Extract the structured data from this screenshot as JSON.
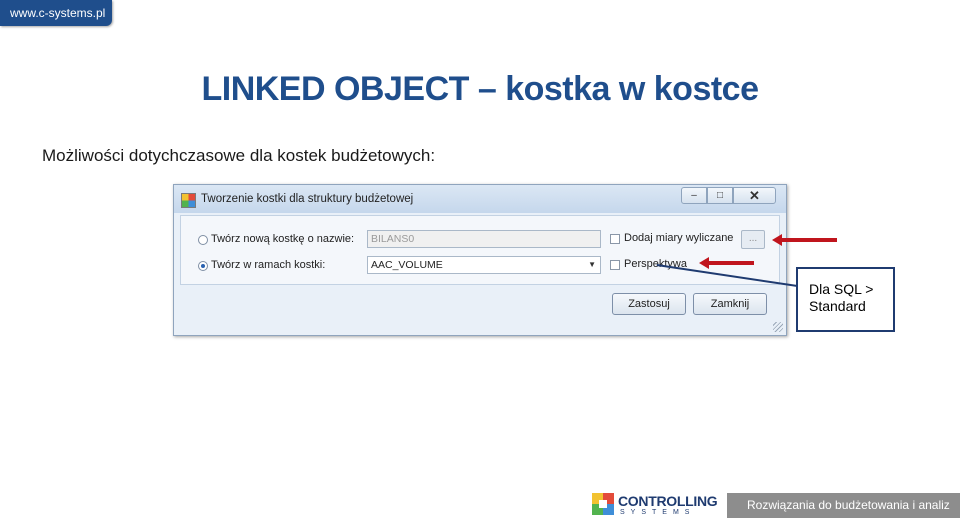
{
  "header": {
    "url_badge": "www.c-systems.pl"
  },
  "slide": {
    "title": "LINKED  OBJECT – kostka w kostce",
    "subtitle": "Możliwości dotychczasowe dla kostek budżetowych:"
  },
  "dialog": {
    "title": "Tworzenie kostki dla struktury budżetowej",
    "window_buttons": {
      "minimize": "–",
      "maximize": "□",
      "close": "✕"
    },
    "options": [
      {
        "label": "Twórz nową kostkę o nazwie:",
        "selected": false,
        "value": "BILANS0",
        "enabled": false
      },
      {
        "label": "Twórz w ramach kostki:",
        "selected": true,
        "value": "AAC_VOLUME",
        "enabled": true
      }
    ],
    "combo_arrow": "▼",
    "checkboxes": [
      {
        "label": "Dodaj miary wyliczane",
        "checked": false
      },
      {
        "label": "Perspektywa",
        "checked": false
      }
    ],
    "ellipsis_button": "...",
    "apply_button": "Zastosuj",
    "close_button": "Zamknij"
  },
  "annotation": {
    "callout_text": "Dla SQL > Standard",
    "arrow_color": "#c0151d",
    "line_color": "#1f3b70"
  },
  "footer": {
    "logo_name": "CONTROLLING",
    "logo_sub": "SYSTEMS",
    "tagline": "Rozwiązania do budżetowania i analiz"
  },
  "colors": {
    "title_blue": "#1f4e8c",
    "footer_gray": "#8d8d8d"
  }
}
